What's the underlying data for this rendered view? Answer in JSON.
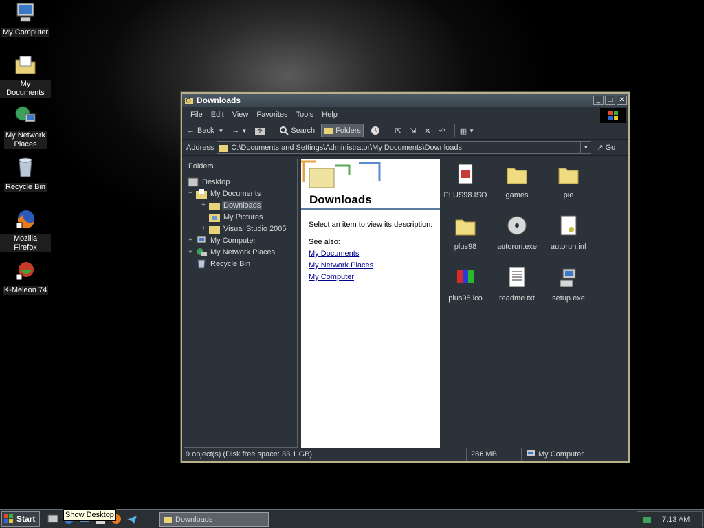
{
  "desktop": {
    "icons": [
      {
        "label": "My Computer"
      },
      {
        "label": "My Documents"
      },
      {
        "label": "My Network\nPlaces"
      },
      {
        "label": "Recycle Bin"
      },
      {
        "label": "Mozilla Firefox"
      },
      {
        "label": "K-Meleon 74"
      }
    ]
  },
  "window": {
    "title": "Downloads",
    "menu": [
      "File",
      "Edit",
      "View",
      "Favorites",
      "Tools",
      "Help"
    ],
    "toolbar": {
      "back": "Back",
      "search": "Search",
      "folders": "Folders"
    },
    "address": {
      "label": "Address",
      "value": "C:\\Documents and Settings\\Administrator\\My Documents\\Downloads",
      "go": "Go"
    },
    "folders_pane": {
      "header": "Folders",
      "tree": [
        {
          "label": "Desktop",
          "expander": ""
        },
        {
          "label": "My Documents",
          "expander": "−"
        },
        {
          "label": "Downloads",
          "expander": "+"
        },
        {
          "label": "My Pictures",
          "expander": ""
        },
        {
          "label": "Visual Studio 2005",
          "expander": "+"
        },
        {
          "label": "My Computer",
          "expander": "+"
        },
        {
          "label": "My Network Places",
          "expander": "+"
        },
        {
          "label": "Recycle Bin",
          "expander": ""
        }
      ]
    },
    "webview": {
      "title": "Downloads",
      "description": "Select an item to view its description.",
      "see_also": "See also:",
      "links": [
        "My Documents",
        "My Network Places",
        "My Computer"
      ]
    },
    "files": [
      {
        "name": "PLUS98.ISO",
        "icon": "disc-image-icon"
      },
      {
        "name": "games",
        "icon": "folder-icon"
      },
      {
        "name": "pie",
        "icon": "folder-icon"
      },
      {
        "name": "plus98",
        "icon": "folder-icon"
      },
      {
        "name": "autorun.exe",
        "icon": "cd-executable-icon"
      },
      {
        "name": "autorun.inf",
        "icon": "settings-file-icon"
      },
      {
        "name": "plus98.ico",
        "icon": "image-icon"
      },
      {
        "name": "readme.txt",
        "icon": "text-file-icon"
      },
      {
        "name": "setup.exe",
        "icon": "setup-icon"
      }
    ],
    "status": {
      "objects": "9 object(s) (Disk free space: 33.1 GB)",
      "size": "286 MB",
      "zone": "My Computer"
    }
  },
  "taskbar": {
    "start": "Start",
    "task": "Downloads",
    "clock": "7:13 AM",
    "tooltip": "Show Desktop"
  },
  "colors": {
    "window_bg": "#2b323a",
    "border": "#b8b08a",
    "link": "#00008b",
    "tooltip_bg": "#ffffe1"
  }
}
